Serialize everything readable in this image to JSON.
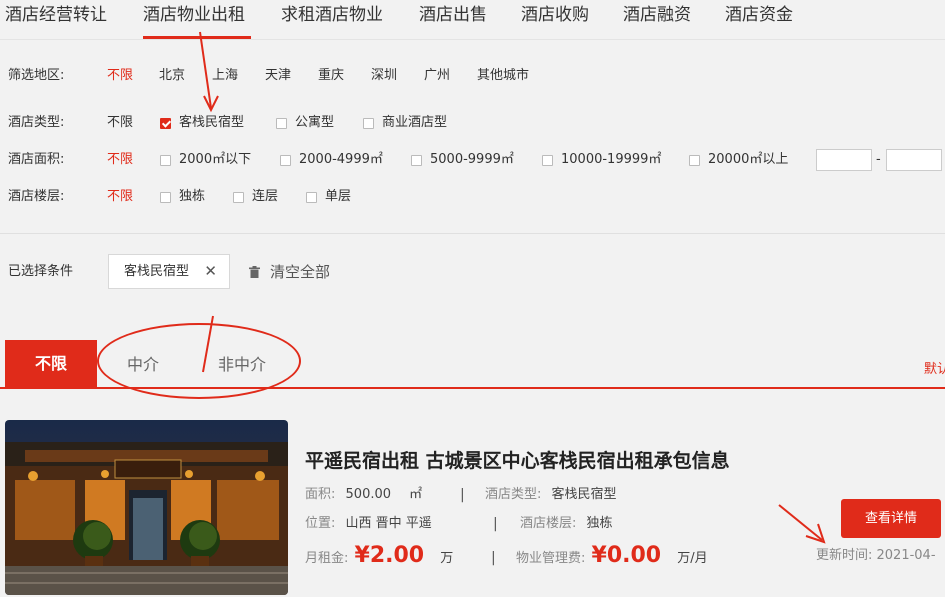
{
  "top_nav": {
    "tabs": [
      "酒店经营转让",
      "酒店物业出租",
      "求租酒店物业",
      "酒店出售",
      "酒店收购",
      "酒店融资",
      "酒店资金"
    ],
    "active_index": 1
  },
  "filters": {
    "region": {
      "label": "筛选地区:",
      "options": [
        "不限",
        "北京",
        "上海",
        "天津",
        "重庆",
        "深圳",
        "广州",
        "其他城市"
      ]
    },
    "hotel_type": {
      "label": "酒店类型:",
      "any": "不限",
      "options": [
        "客栈民宿型",
        "公寓型",
        "商业酒店型"
      ],
      "checked": [
        true,
        false,
        false
      ]
    },
    "area": {
      "label": "酒店面积:",
      "any": "不限",
      "options": [
        "2000㎡以下",
        "2000-4999㎡",
        "5000-9999㎡",
        "10000-19999㎡",
        "20000㎡以上"
      ],
      "range_dash": "-"
    },
    "floors": {
      "label": "酒店楼层:",
      "any": "不限",
      "options": [
        "独栋",
        "连层",
        "单层"
      ]
    }
  },
  "selected": {
    "label": "已选择条件",
    "chip": "客栈民宿型",
    "chip_close": "✕",
    "clear_all": "清空全部"
  },
  "agent_tabs": {
    "items": [
      "不限",
      "中介",
      "非中介"
    ],
    "active_index": 0,
    "sort_label": "默认"
  },
  "listing": {
    "title": "平遥民宿出租 古城景区中心客栈民宿出租承包信息",
    "area_key": "面积:",
    "area_value": "500.00",
    "area_unit": "㎡",
    "type_key": "酒店类型:",
    "type_value": "客栈民宿型",
    "location_key": "位置:",
    "location_value": "山西 晋中 平遥",
    "floor_key": "酒店楼层:",
    "floor_value": "独栋",
    "rent_key": "月租金:",
    "rent_value": "¥2.00",
    "rent_unit": "万",
    "mgmt_key": "物业管理费:",
    "mgmt_value": "¥0.00",
    "mgmt_unit": "万/月",
    "separator": "|",
    "button": "查看详情",
    "update_time": "更新时间: 2021-04-"
  },
  "colors": {
    "accent": "#e02b1a",
    "background": "#f2f2f2"
  }
}
